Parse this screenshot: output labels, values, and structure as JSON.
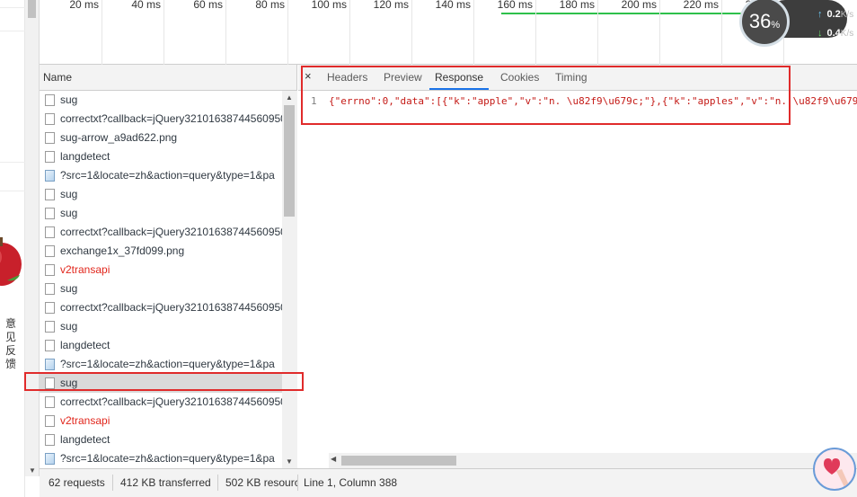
{
  "timeline": {
    "ticks": [
      "20 ms",
      "40 ms",
      "60 ms",
      "80 ms",
      "100 ms",
      "120 ms",
      "140 ms",
      "160 ms",
      "180 ms",
      "200 ms",
      "220 ms",
      "240 ms"
    ]
  },
  "speed_widget": {
    "percent": "36",
    "percent_unit": "%",
    "up_value": "0.2",
    "down_value": "0.4",
    "unit": "K/s",
    "up_arrow": "↑",
    "down_arrow": "↓"
  },
  "page": {
    "feedback_line1": "意见",
    "feedback_line2": "反馈"
  },
  "requests": {
    "header": "Name",
    "items": [
      {
        "label": "sug",
        "icon": "doc-icon",
        "error": false
      },
      {
        "label": "correctxt?callback=jQuery32101638744560950",
        "icon": "doc-icon",
        "error": false
      },
      {
        "label": "sug-arrow_a9ad622.png",
        "icon": "doc-icon",
        "error": false
      },
      {
        "label": "langdetect",
        "icon": "doc-icon",
        "error": false
      },
      {
        "label": "?src=1&locate=zh&action=query&type=1&pa",
        "icon": "image-icon",
        "error": false
      },
      {
        "label": "sug",
        "icon": "doc-icon",
        "error": false
      },
      {
        "label": "sug",
        "icon": "doc-icon",
        "error": false
      },
      {
        "label": "correctxt?callback=jQuery32101638744560950",
        "icon": "doc-icon",
        "error": false
      },
      {
        "label": "exchange1x_37fd099.png",
        "icon": "doc-icon",
        "error": false
      },
      {
        "label": "v2transapi",
        "icon": "doc-icon",
        "error": true
      },
      {
        "label": "sug",
        "icon": "doc-icon",
        "error": false
      },
      {
        "label": "correctxt?callback=jQuery32101638744560950",
        "icon": "doc-icon",
        "error": false
      },
      {
        "label": "sug",
        "icon": "doc-icon",
        "error": false
      },
      {
        "label": "langdetect",
        "icon": "doc-icon",
        "error": false
      },
      {
        "label": "?src=1&locate=zh&action=query&type=1&pa",
        "icon": "image-icon",
        "error": false
      },
      {
        "label": "sug",
        "icon": "doc-icon",
        "error": false,
        "selected": true
      },
      {
        "label": "correctxt?callback=jQuery32101638744560950",
        "icon": "doc-icon",
        "error": false
      },
      {
        "label": "v2transapi",
        "icon": "doc-icon",
        "error": true
      },
      {
        "label": "langdetect",
        "icon": "doc-icon",
        "error": false
      },
      {
        "label": "?src=1&locate=zh&action=query&type=1&pa",
        "icon": "image-icon",
        "error": false
      }
    ]
  },
  "detail": {
    "close": "×",
    "tabs": [
      "Headers",
      "Preview",
      "Response",
      "Cookies",
      "Timing"
    ],
    "active_tab": "Response",
    "line_number": "1",
    "response_text": "{\"errno\":0,\"data\":[{\"k\":\"apple\",\"v\":\"n. \\u82f9\\u679c;\"},{\"k\":\"apples\",\"v\":\"n. \\u82f9\\u679"
  },
  "status": {
    "requests": "62 requests",
    "transferred": "412 KB transferred",
    "resources": "502 KB resourc",
    "cursor": "Line 1, Column 388"
  },
  "colors": {
    "accent": "#1a73e8",
    "error": "#e1261c",
    "highlight": "#e02b2b",
    "progress": "#2ec04b"
  }
}
